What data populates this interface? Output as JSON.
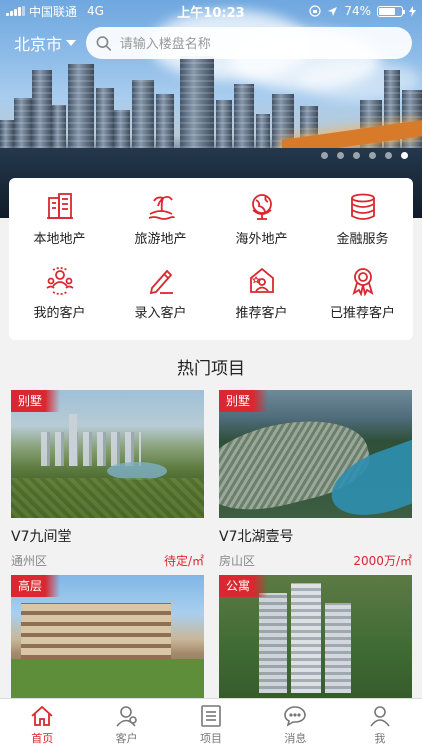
{
  "status_bar": {
    "carrier": "中国联通",
    "network": "4G",
    "time": "上午10:23",
    "battery": "74%",
    "battery_level": 0.74
  },
  "header": {
    "city": "北京市",
    "search_placeholder": "请输入楼盘名称"
  },
  "banner": {
    "page_count": 6,
    "active_index": 5
  },
  "categories": [
    {
      "label": "本地地产",
      "icon": "building-icon"
    },
    {
      "label": "旅游地产",
      "icon": "palm-island-icon"
    },
    {
      "label": "海外地产",
      "icon": "globe-icon"
    },
    {
      "label": "金融服务",
      "icon": "coin-stack-icon"
    },
    {
      "label": "我的客户",
      "icon": "customers-icon"
    },
    {
      "label": "录入客户",
      "icon": "pencil-icon"
    },
    {
      "label": "推荐客户",
      "icon": "recommend-icon"
    },
    {
      "label": "已推荐客户",
      "icon": "award-icon"
    }
  ],
  "section_title": "热门项目",
  "projects": [
    {
      "tag": "别墅",
      "name": "V7九间堂",
      "district": "通州区",
      "price": "待定/㎡"
    },
    {
      "tag": "别墅",
      "name": "V7北湖壹号",
      "district": "房山区",
      "price": "2000万/㎡"
    },
    {
      "tag": "高层",
      "name": "",
      "district": "",
      "price": ""
    },
    {
      "tag": "公寓",
      "name": "",
      "district": "",
      "price": ""
    }
  ],
  "tabs": [
    {
      "label": "首页",
      "icon": "home-icon",
      "active": true
    },
    {
      "label": "客户",
      "icon": "customer-icon",
      "active": false
    },
    {
      "label": "项目",
      "icon": "list-icon",
      "active": false
    },
    {
      "label": "消息",
      "icon": "message-icon",
      "active": false
    },
    {
      "label": "我",
      "icon": "profile-icon",
      "active": false
    }
  ],
  "colors": {
    "accent": "#d9282f"
  }
}
